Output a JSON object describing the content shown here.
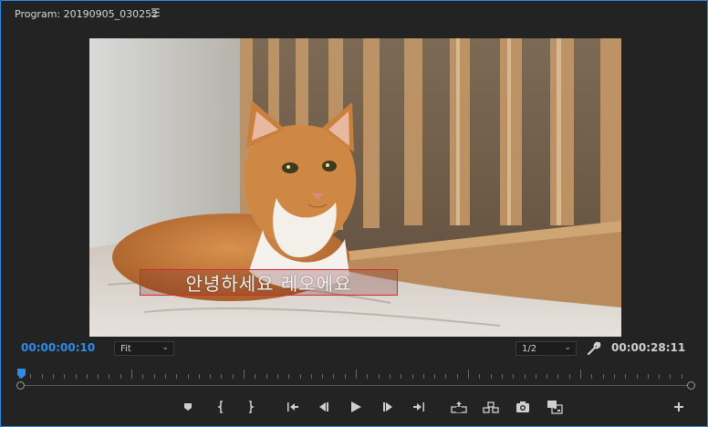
{
  "panel": {
    "title": "Program: 20190905_030252",
    "menu_icon": "hamburger-menu-icon",
    "accent_color": "#2d8ceb"
  },
  "viewer": {
    "caption": "안녕하세요 레오에요"
  },
  "controls": {
    "current_timecode": "00:00:00:10",
    "zoom_value": "Fit",
    "resolution_value": "1/2",
    "duration_timecode": "00:00:28:11",
    "settings_icon": "wrench-icon"
  },
  "transport": {
    "buttons": [
      {
        "icon": "add-marker-icon"
      },
      {
        "icon": "mark-in-icon"
      },
      {
        "icon": "mark-out-icon"
      },
      {
        "icon": "go-to-in-icon"
      },
      {
        "icon": "step-back-icon"
      },
      {
        "icon": "play-icon"
      },
      {
        "icon": "step-forward-icon"
      },
      {
        "icon": "go-to-out-icon"
      },
      {
        "icon": "lift-icon"
      },
      {
        "icon": "extract-icon"
      },
      {
        "icon": "export-frame-icon"
      },
      {
        "icon": "comparison-view-icon"
      },
      {
        "icon": "add-button-icon"
      }
    ]
  }
}
